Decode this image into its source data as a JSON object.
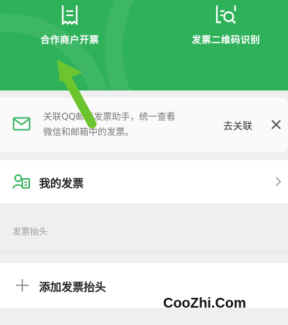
{
  "header": {
    "items": [
      {
        "label": "合作商户开票",
        "icon": "receipt-icon"
      },
      {
        "label": "发票二维码识别",
        "icon": "scan-icon"
      }
    ],
    "background_color": "#2fb15a"
  },
  "notice": {
    "icon": "mail-icon",
    "text_line1": "关联QQ邮箱发票助手，统一查看",
    "text_line2": "微信和邮箱中的发票。",
    "link_label": "去关联",
    "close_icon": "close-icon"
  },
  "my_invoice": {
    "label": "我的发票",
    "icon": "user-invoice-icon"
  },
  "invoice_header_section": {
    "title": "发票抬头",
    "add_label": "添加发票抬头"
  },
  "annotation": {
    "arrow_color": "#6cc52e"
  },
  "watermark": "CooZhi.Com"
}
